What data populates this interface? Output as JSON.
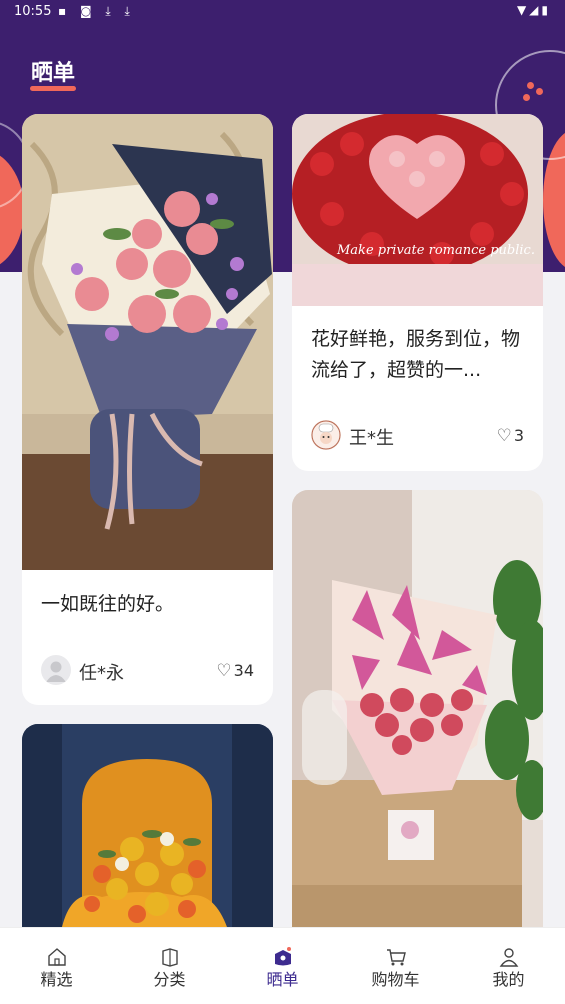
{
  "status_bar": {
    "time": "10:55"
  },
  "page": {
    "title": "晒单"
  },
  "posts": [
    {
      "text": "一如既往的好。",
      "user": "任*永",
      "likes": "34",
      "photo": "pink roses bouquet"
    },
    {
      "text": "花好鲜艳，服务到位，物流给了，超赞的一...",
      "user": "王*生",
      "likes": "3",
      "photo": "red and pink roses heart bouquet",
      "photo_caption": "Make private romance public."
    },
    {
      "photo": "sunflower and orange roses bouquet"
    },
    {
      "photo": "pink lilies and carnations bouquet"
    }
  ],
  "tabs": [
    {
      "label": "精选",
      "icon": "home-icon"
    },
    {
      "label": "分类",
      "icon": "category-icon"
    },
    {
      "label": "晒单",
      "icon": "showcase-icon",
      "active": true
    },
    {
      "label": "购物车",
      "icon": "cart-icon"
    },
    {
      "label": "我的",
      "icon": "profile-icon"
    }
  ],
  "colors": {
    "header": "#3d1f6e",
    "accent": "#f0685a",
    "active_tab": "#3d2b8f"
  }
}
